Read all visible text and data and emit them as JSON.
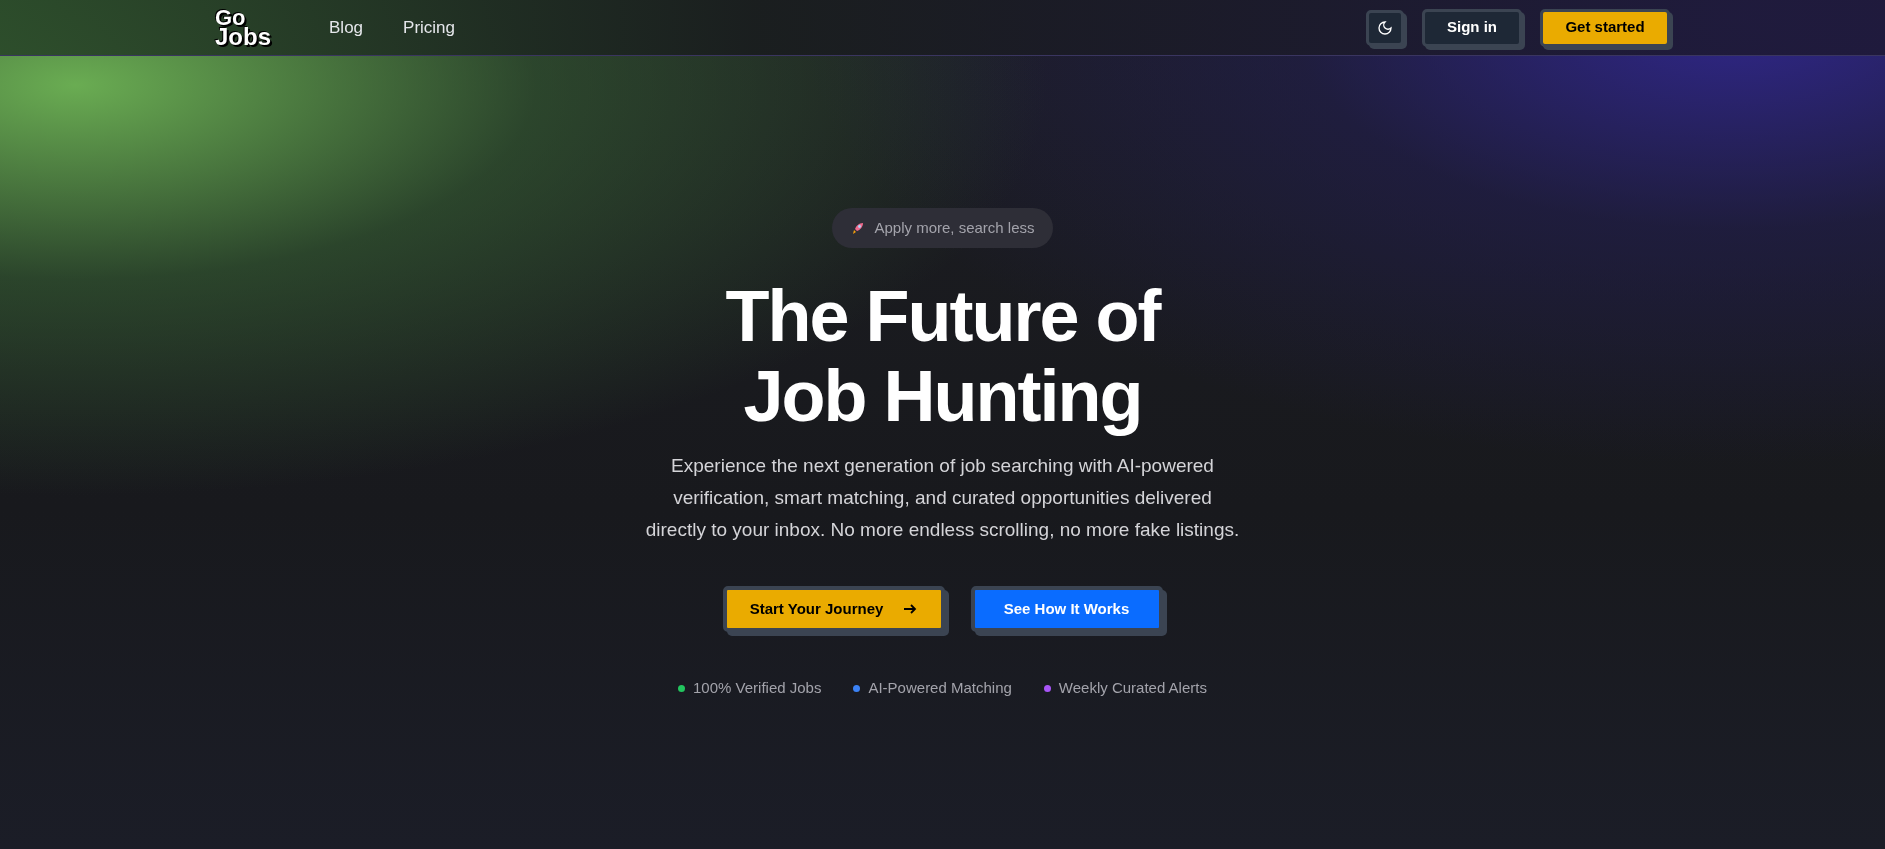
{
  "header": {
    "logo": [
      "Go",
      "Jobs"
    ],
    "nav": [
      {
        "label": "Blog"
      },
      {
        "label": "Pricing"
      }
    ],
    "buttons": [
      {
        "label": "Sign in",
        "kind": "secondary"
      },
      {
        "label": "Get started",
        "kind": "primary"
      }
    ]
  },
  "hero": {
    "badge": "Apply more, search less",
    "title": [
      "The Future of",
      "Job Hunting"
    ],
    "description": "Experience the next generation of job searching with AI-powered verification, smart matching, and curated opportunities delivered directly to your inbox. No more endless scrolling, no more fake listings.",
    "buttons": [
      {
        "label": "Start Your Journey",
        "kind": "primary",
        "arrow": true
      },
      {
        "label": "See How It Works",
        "kind": "info",
        "arrow": false
      }
    ],
    "features": [
      {
        "label": "100% Verified Jobs",
        "color": "#22c55e"
      },
      {
        "label": "AI-Powered Matching",
        "color": "#3b82f6"
      },
      {
        "label": "Weekly Curated Alerts",
        "color": "#a855f7"
      }
    ]
  }
}
